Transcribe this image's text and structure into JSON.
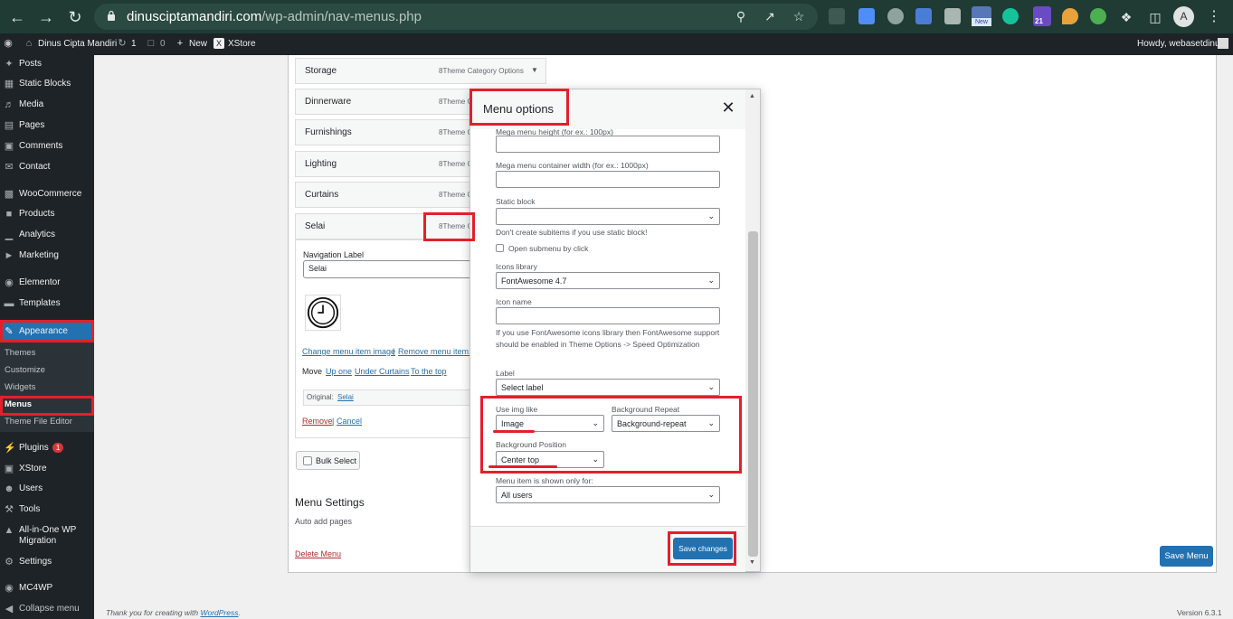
{
  "browser": {
    "url_domain": "dinusciptamandiri.com",
    "url_path": "/wp-admin/nav-menus.php",
    "avatar_letter": "A",
    "ext_badges": [
      "New",
      "21"
    ]
  },
  "adminbar": {
    "site_name": "Dinus Cipta Mandiri",
    "updates_count": "1",
    "comments_count": "0",
    "new_label": "New",
    "theme_label": "XStore",
    "greeting": "Howdy, webasetdinus"
  },
  "sidebar": {
    "items": [
      {
        "label": "Posts",
        "icon": "pin-icon"
      },
      {
        "label": "Static Blocks",
        "icon": "grid-icon"
      },
      {
        "label": "Media",
        "icon": "media-icon"
      },
      {
        "label": "Pages",
        "icon": "page-icon"
      },
      {
        "label": "Comments",
        "icon": "comment-icon"
      },
      {
        "label": "Contact",
        "icon": "mail-icon"
      },
      {
        "label": "WooCommerce",
        "icon": "woo-icon"
      },
      {
        "label": "Products",
        "icon": "box-icon"
      },
      {
        "label": "Analytics",
        "icon": "chart-icon"
      },
      {
        "label": "Marketing",
        "icon": "megaphone-icon"
      },
      {
        "label": "Elementor",
        "icon": "elementor-icon"
      },
      {
        "label": "Templates",
        "icon": "folder-icon"
      },
      {
        "label": "Appearance",
        "icon": "brush-icon"
      },
      {
        "label": "Plugins",
        "icon": "plug-icon"
      },
      {
        "label": "XStore",
        "icon": "xstore-icon"
      },
      {
        "label": "Users",
        "icon": "user-icon"
      },
      {
        "label": "Tools",
        "icon": "wrench-icon"
      },
      {
        "label": "All-in-One WP Migration",
        "icon": "migration-icon"
      },
      {
        "label": "Settings",
        "icon": "settings-icon"
      },
      {
        "label": "MC4WP",
        "icon": "mc4wp-icon"
      },
      {
        "label": "Collapse menu",
        "icon": "collapse-icon"
      }
    ],
    "appearance_sub": [
      "Themes",
      "Customize",
      "Widgets",
      "Menus",
      "Theme File Editor"
    ],
    "plugins_badge": "1"
  },
  "menu_items": [
    {
      "title": "Storage",
      "type": "8Theme Category Options"
    },
    {
      "title": "Dinnerware",
      "type": "8Theme C"
    },
    {
      "title": "Furnishings",
      "type": "8Theme C"
    },
    {
      "title": "Lighting",
      "type": "8Theme C"
    },
    {
      "title": "Curtains",
      "type": "8Theme C"
    },
    {
      "title": "Selai",
      "type": "8Theme C"
    }
  ],
  "selai_panel": {
    "nav_label": "Navigation Label",
    "nav_value": "Selai",
    "change_image": "Change menu item image",
    "remove_image": "Remove menu item i",
    "move_label": "Move",
    "up_one": "Up one",
    "under_curtains": "Under Curtains",
    "to_top": "To the top",
    "original_label": "Original:",
    "original_value": "Selai",
    "remove": "Remove",
    "separator": "|",
    "cancel": "Cancel"
  },
  "bulk_select": "Bulk Select",
  "menu_settings": {
    "title": "Menu Settings",
    "auto_add": "Auto add pages",
    "delete_menu": "Delete Menu",
    "save_menu": "Save Menu"
  },
  "modal": {
    "title": "Menu options",
    "mega_height_label": "Mega menu height (for ex.: 100px)",
    "mega_width_label": "Mega menu container width (for ex.: 1000px)",
    "static_block_label": "Static block",
    "static_block_value": "",
    "static_block_note": "Don't create subitems if you use static block!",
    "open_submenu": "Open submenu by click",
    "icons_library_label": "Icons library",
    "icons_library_value": "FontAwesome 4.7",
    "icon_name_label": "Icon name",
    "icon_note": "If you use FontAwesome icons library then FontAwesome support should be enabled in Theme Options -> Speed Optimization",
    "label_label": "Label",
    "label_value": "Select label",
    "use_img_label": "Use img like",
    "use_img_value": "Image",
    "bg_repeat_label": "Background Repeat",
    "bg_repeat_value": "Background-repeat",
    "bg_position_label": "Background Position",
    "bg_position_value": "Center top",
    "shown_for_label": "Menu item is shown only for:",
    "shown_for_value": "All users",
    "save_changes": "Save changes"
  },
  "footer": {
    "thanks_prefix": "Thank you for creating with",
    "thanks_link": "WordPress",
    "thanks_suffix": ".",
    "version": "Version 6.3.1"
  },
  "colors": {
    "chrome_bg": "#1f3b34",
    "admin_dark": "#1d2327",
    "wp_blue": "#2271b1",
    "highlight_red": "#e3202a"
  }
}
